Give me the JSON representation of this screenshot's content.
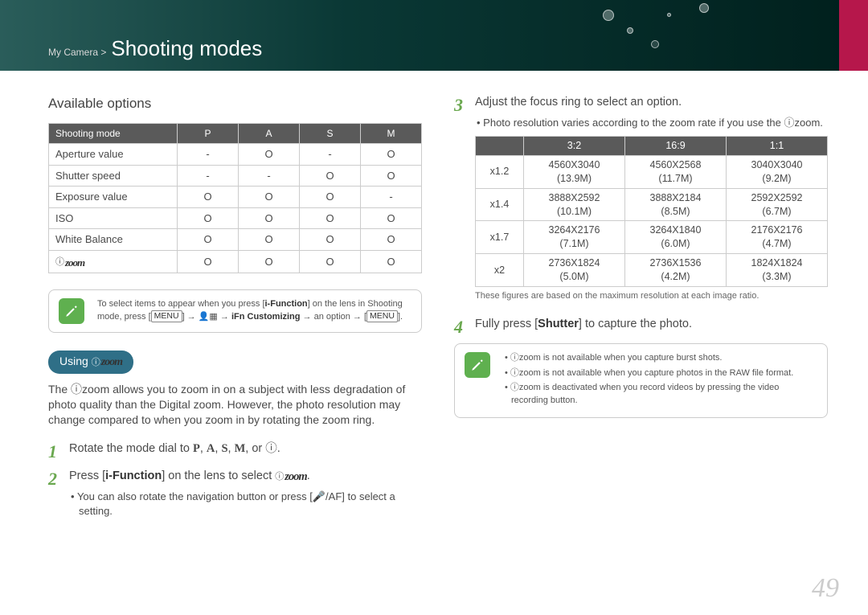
{
  "header": {
    "breadcrumb": "My Camera >",
    "title": "Shooting modes"
  },
  "left": {
    "section_title": "Available options",
    "table": {
      "head": [
        "Shooting mode",
        "P",
        "A",
        "S",
        "M"
      ],
      "rows": [
        [
          "Aperture value",
          "-",
          "O",
          "-",
          "O"
        ],
        [
          "Shutter speed",
          "-",
          "-",
          "O",
          "O"
        ],
        [
          "Exposure value",
          "O",
          "O",
          "O",
          "-"
        ],
        [
          "ISO",
          "O",
          "O",
          "O",
          "O"
        ],
        [
          "White Balance",
          "O",
          "O",
          "O",
          "O"
        ],
        [
          "__izoom__",
          "O",
          "O",
          "O",
          "O"
        ]
      ]
    },
    "note_parts": {
      "a": "To select items to appear when you press [",
      "b": "i-Function",
      "c": "] on the lens in Shooting mode, press [",
      "d": "MENU",
      "e": "] → ",
      "user_icon": "👤▦",
      "f": " → ",
      "g": "iFn Customizing",
      "h": " → an option → [",
      "i": "MENU",
      "j": "]."
    },
    "pill_label": "Using ",
    "izoom_text": "zoom",
    "para": "The ⓘzoom allows you to zoom in on a subject with less degradation of photo quality than the Digital zoom. However, the photo resolution may change compared to when you zoom in by rotating the zoom ring.",
    "step1_a": "Rotate the mode dial to ",
    "step1_modes": [
      "P",
      "A",
      "S",
      "M"
    ],
    "step1_b": ", or ⓘ.",
    "step2_a": "Press [",
    "step2_b": "i-Function",
    "step2_c": "] on the lens to select ",
    "step2_sub": "You can also rotate the navigation button or press [🎤/AF] to select a setting."
  },
  "right": {
    "step3": "Adjust the focus ring to select an option.",
    "step3_sub": "Photo resolution varies according to the zoom rate if you use the ⓘzoom.",
    "res_table": {
      "head": [
        "",
        "3:2",
        "16:9",
        "1:1"
      ],
      "rows": [
        {
          "z": "x1.2",
          "cells": [
            [
              "4560X3040",
              "(13.9M)"
            ],
            [
              "4560X2568",
              "(11.7M)"
            ],
            [
              "3040X3040",
              "(9.2M)"
            ]
          ]
        },
        {
          "z": "x1.4",
          "cells": [
            [
              "3888X2592",
              "(10.1M)"
            ],
            [
              "3888X2184",
              "(8.5M)"
            ],
            [
              "2592X2592",
              "(6.7M)"
            ]
          ]
        },
        {
          "z": "x1.7",
          "cells": [
            [
              "3264X2176",
              "(7.1M)"
            ],
            [
              "3264X1840",
              "(6.0M)"
            ],
            [
              "2176X2176",
              "(4.7M)"
            ]
          ]
        },
        {
          "z": "x2",
          "cells": [
            [
              "2736X1824",
              "(5.0M)"
            ],
            [
              "2736X1536",
              "(4.2M)"
            ],
            [
              "1824X1824",
              "(3.3M)"
            ]
          ]
        }
      ]
    },
    "caption": "These figures are based on the maximum resolution at each image ratio.",
    "step4_a": "Fully press [",
    "step4_b": "Shutter",
    "step4_c": "] to capture the photo.",
    "notes": [
      "ⓘzoom is not available when you capture burst shots.",
      "ⓘzoom is not available when you capture photos in the RAW file format.",
      "ⓘzoom is deactivated when you record videos by pressing the video recording button."
    ]
  },
  "page": "49"
}
